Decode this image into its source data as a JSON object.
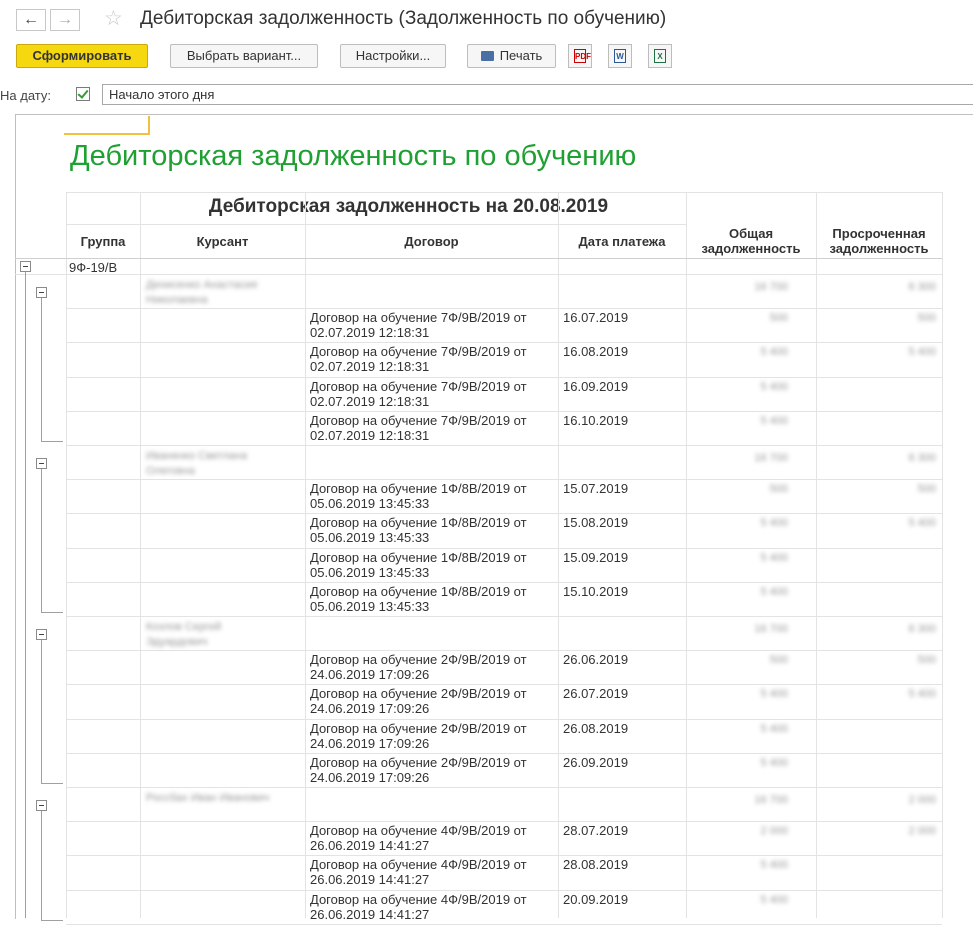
{
  "window": {
    "title": "Дебиторская задолженность (Задолженность по обучению)",
    "back_icon": "←",
    "forward_icon": "→",
    "star_icon": "☆"
  },
  "toolbar": {
    "generate_label": "Сформировать",
    "variant_label": "Выбрать вариант...",
    "settings_label": "Настройки...",
    "print_label": "Печать",
    "pdf_label": "PDF",
    "word_label": "W",
    "excel_label": "X"
  },
  "filter": {
    "date_label": "На дату:",
    "date_checked": true,
    "date_value": "Начало этого дня"
  },
  "report": {
    "title": "Дебиторская задолженность по обучению",
    "subtitle": "Дебиторская задолженность на 20.08.2019",
    "columns": {
      "group": "Группа",
      "student": "Курсант",
      "contract": "Договор",
      "pay_date": "Дата платежа",
      "total": "Общая задолженность",
      "overdue": "Просроченная задолженность"
    },
    "group_name": "9Ф-19/В",
    "students": [
      {
        "name_line1": "Денисенко Анастасия",
        "name_line2": "Николаевна",
        "total": "16 700",
        "overdue": "6 300",
        "rows": [
          {
            "contract1": "Договор на обучение 7Ф/9В/2019 от",
            "contract2": "02.07.2019 12:18:31",
            "date": "16.07.2019",
            "total": "500",
            "overdue": "500"
          },
          {
            "contract1": "Договор на обучение 7Ф/9В/2019 от",
            "contract2": "02.07.2019 12:18:31",
            "date": "16.08.2019",
            "total": "5 400",
            "overdue": "5 400"
          },
          {
            "contract1": "Договор на обучение 7Ф/9В/2019 от",
            "contract2": "02.07.2019 12:18:31",
            "date": "16.09.2019",
            "total": "5 400",
            "overdue": ""
          },
          {
            "contract1": "Договор на обучение 7Ф/9В/2019 от",
            "contract2": "02.07.2019 12:18:31",
            "date": "16.10.2019",
            "total": "5 400",
            "overdue": ""
          }
        ]
      },
      {
        "name_line1": "Иваненко Светлана",
        "name_line2": "Олеговна",
        "total": "16 700",
        "overdue": "6 300",
        "rows": [
          {
            "contract1": "Договор на обучение 1Ф/8В/2019 от",
            "contract2": "05.06.2019 13:45:33",
            "date": "15.07.2019",
            "total": "500",
            "overdue": "500"
          },
          {
            "contract1": "Договор на обучение 1Ф/8В/2019 от",
            "contract2": "05.06.2019 13:45:33",
            "date": "15.08.2019",
            "total": "5 400",
            "overdue": "5 400"
          },
          {
            "contract1": "Договор на обучение 1Ф/8В/2019 от",
            "contract2": "05.06.2019 13:45:33",
            "date": "15.09.2019",
            "total": "5 400",
            "overdue": ""
          },
          {
            "contract1": "Договор на обучение 1Ф/8В/2019 от",
            "contract2": "05.06.2019 13:45:33",
            "date": "15.10.2019",
            "total": "5 400",
            "overdue": ""
          }
        ]
      },
      {
        "name_line1": "Козлов Сергей",
        "name_line2": "Эдуардович",
        "total": "16 700",
        "overdue": "6 300",
        "rows": [
          {
            "contract1": "Договор на обучение 2Ф/9В/2019 от",
            "contract2": "24.06.2019 17:09:26",
            "date": "26.06.2019",
            "total": "500",
            "overdue": "500"
          },
          {
            "contract1": "Договор на обучение 2Ф/9В/2019 от",
            "contract2": "24.06.2019 17:09:26",
            "date": "26.07.2019",
            "total": "5 400",
            "overdue": "5 400"
          },
          {
            "contract1": "Договор на обучение 2Ф/9В/2019 от",
            "contract2": "24.06.2019 17:09:26",
            "date": "26.08.2019",
            "total": "5 400",
            "overdue": ""
          },
          {
            "contract1": "Договор на обучение 2Ф/9В/2019 от",
            "contract2": "24.06.2019 17:09:26",
            "date": "26.09.2019",
            "total": "5 400",
            "overdue": ""
          }
        ]
      },
      {
        "name_line1": "Россбах Иван Иванович",
        "name_line2": "",
        "total": "16 700",
        "overdue": "2 000",
        "rows": [
          {
            "contract1": "Договор на обучение 4Ф/9В/2019 от",
            "contract2": "26.06.2019 14:41:27",
            "date": "28.07.2019",
            "total": "2 000",
            "overdue": "2 000"
          },
          {
            "contract1": "Договор на обучение 4Ф/9В/2019 от",
            "contract2": "26.06.2019 14:41:27",
            "date": "28.08.2019",
            "total": "5 400",
            "overdue": ""
          },
          {
            "contract1": "Договор на обучение 4Ф/9В/2019 от",
            "contract2": "26.06.2019 14:41:27",
            "date": "20.09.2019",
            "total": "5 400",
            "overdue": ""
          }
        ]
      }
    ]
  }
}
